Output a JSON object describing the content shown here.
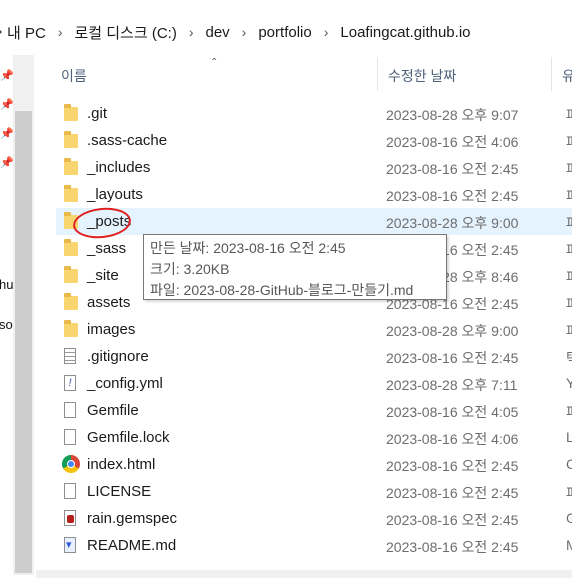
{
  "breadcrumb": {
    "lead": "›",
    "items": [
      "내 PC",
      "로컬 디스크 (C:)",
      "dev",
      "portfolio",
      "Loafingcat.github.io"
    ]
  },
  "nav": {
    "partial_labels": [
      "hu",
      "so"
    ]
  },
  "header": {
    "name": "이름",
    "date": "수정한 날짜",
    "type": "유"
  },
  "files": [
    {
      "name": ".git",
      "date": "2023-08-28 오후 9:07",
      "type": "파",
      "icon": "folder-icon"
    },
    {
      "name": ".sass-cache",
      "date": "2023-08-16 오전 4:06",
      "type": "파",
      "icon": "folder-icon"
    },
    {
      "name": "_includes",
      "date": "2023-08-16 오전 2:45",
      "type": "파",
      "icon": "folder-icon"
    },
    {
      "name": "_layouts",
      "date": "2023-08-16 오전 2:45",
      "type": "파",
      "icon": "folder-icon"
    },
    {
      "name": "_posts",
      "date": "2023-08-28 오후 9:00",
      "type": "파",
      "icon": "folder-icon",
      "selected": true
    },
    {
      "name": "_sass",
      "date": "2023-08-16 오전 2:45",
      "type": "파",
      "icon": "folder-icon"
    },
    {
      "name": "_site",
      "date": "2023-08-28 오후 8:46",
      "type": "파",
      "icon": "folder-icon"
    },
    {
      "name": "assets",
      "date": "2023-08-16 오전 2:45",
      "type": "파",
      "icon": "folder-icon"
    },
    {
      "name": "images",
      "date": "2023-08-28 오후 9:00",
      "type": "파",
      "icon": "folder-icon"
    },
    {
      "name": ".gitignore",
      "date": "2023-08-16 오전 2:45",
      "type": "텍",
      "icon": "lines-icon"
    },
    {
      "name": "_config.yml",
      "date": "2023-08-28 오후 7:11",
      "type": "Y",
      "icon": "yml-icon"
    },
    {
      "name": "Gemfile",
      "date": "2023-08-16 오전 4:05",
      "type": "파",
      "icon": "doc-icon"
    },
    {
      "name": "Gemfile.lock",
      "date": "2023-08-16 오전 4:06",
      "type": "L",
      "icon": "doc-icon"
    },
    {
      "name": "index.html",
      "date": "2023-08-16 오전 2:45",
      "type": "C",
      "icon": "chrome-icon"
    },
    {
      "name": "LICENSE",
      "date": "2023-08-16 오전 2:45",
      "type": "파",
      "icon": "doc-icon"
    },
    {
      "name": "rain.gemspec",
      "date": "2023-08-16 오전 2:45",
      "type": "G",
      "icon": "gem-icon"
    },
    {
      "name": "README.md",
      "date": "2023-08-16 오전 2:45",
      "type": "M",
      "icon": "md-icon"
    }
  ],
  "tooltip": {
    "created": "만든 날짜: 2023-08-16 오전 2:45",
    "size": "크기: 3.20KB",
    "files": "파일: 2023-08-28-GitHub-블로그-만들기.md"
  }
}
